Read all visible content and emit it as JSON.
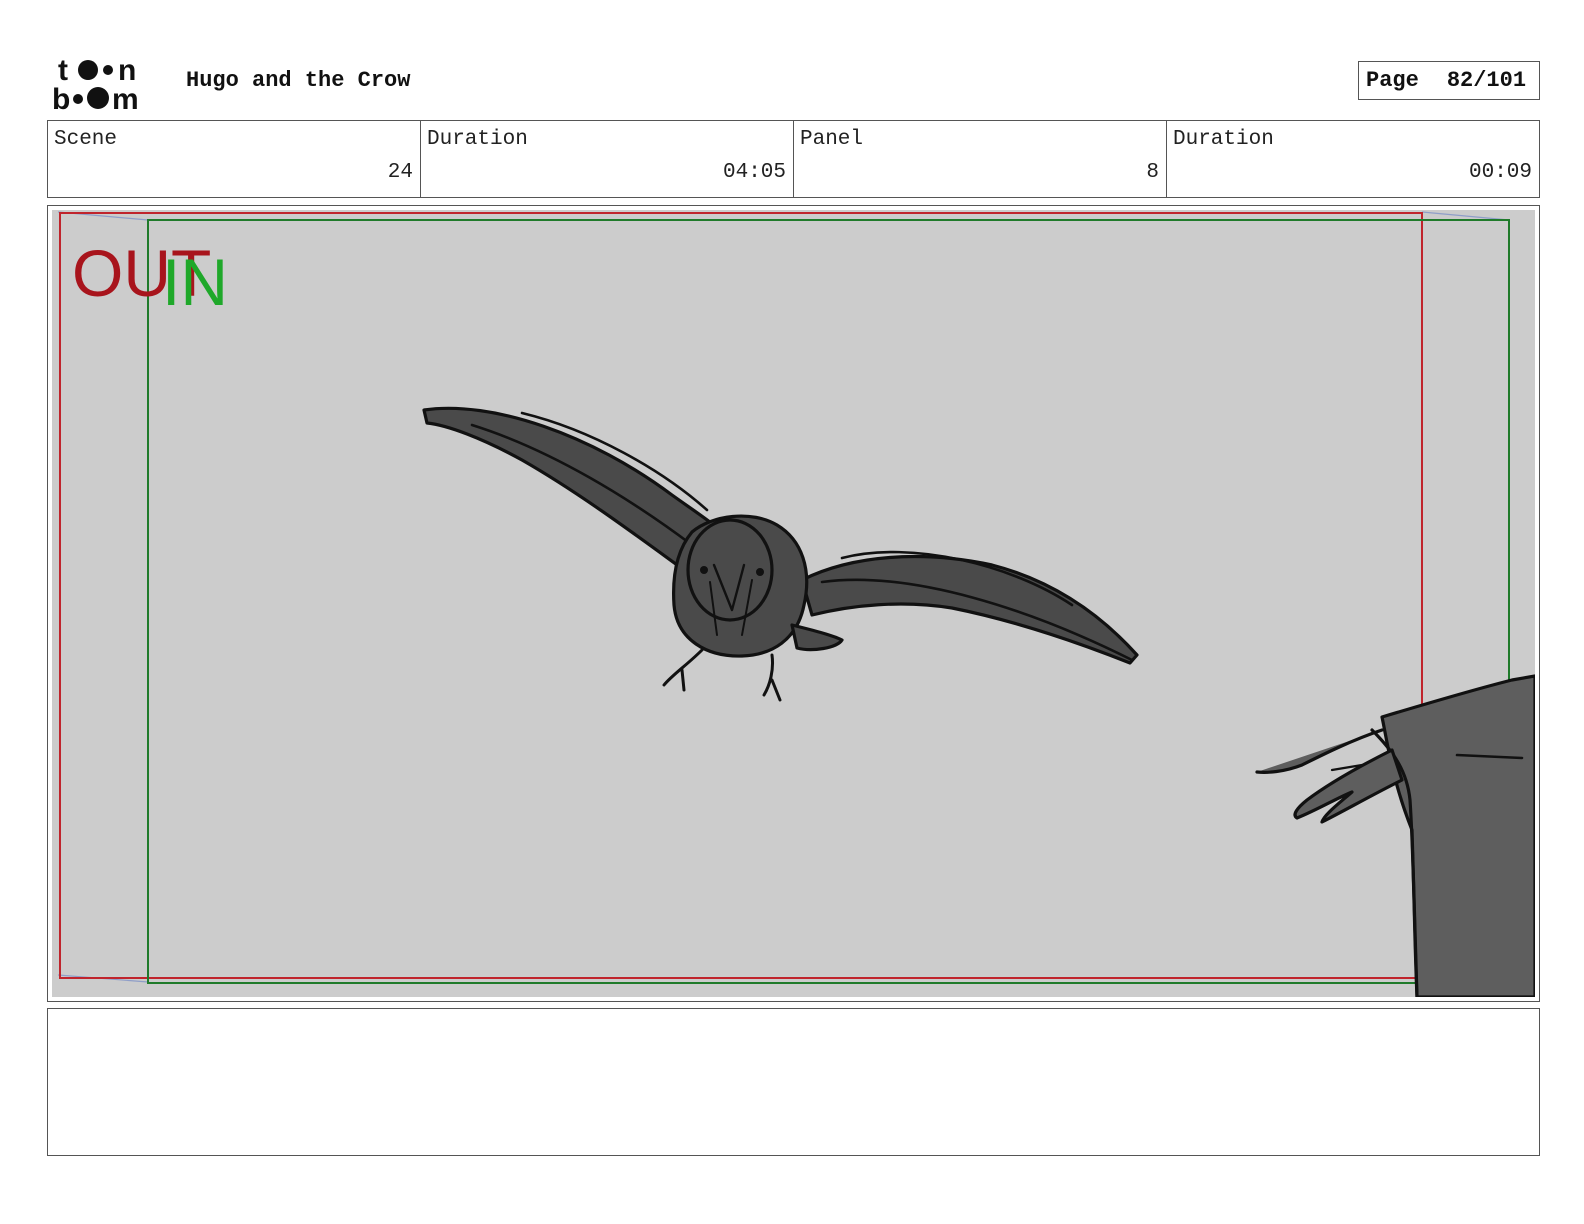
{
  "header": {
    "logo_text": [
      "toon",
      "boom"
    ],
    "title": "Hugo and the Crow",
    "page_label": "Page",
    "page_number": "82/101"
  },
  "info": {
    "scene_label": "Scene",
    "scene_value": "24",
    "scene_duration_label": "Duration",
    "scene_duration_value": "04:05",
    "panel_label": "Panel",
    "panel_value": "8",
    "panel_duration_label": "Duration",
    "panel_duration_value": "00:09"
  },
  "panel": {
    "out_label": "OUT",
    "in_label": "IN",
    "colors": {
      "out_frame": "#c0242c",
      "in_frame": "#1f7a2a",
      "out_text": "#a8141c",
      "in_text": "#1fa82a",
      "background": "#cccccc",
      "crow_fill": "#4a4a4a",
      "hand_fill": "#5e5e5e"
    }
  },
  "notes": {
    "text": ""
  }
}
